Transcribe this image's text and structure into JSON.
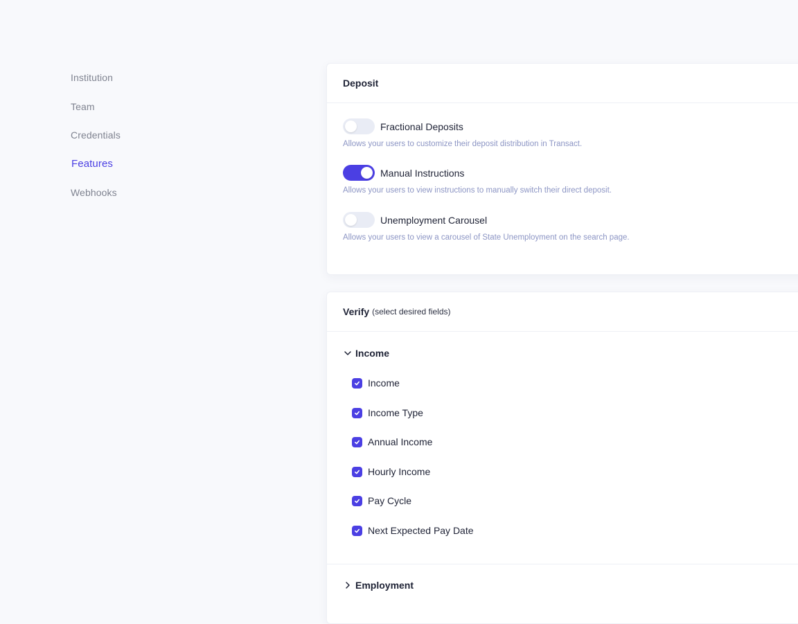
{
  "sidebar": {
    "items": [
      {
        "label": "Institution",
        "active": false
      },
      {
        "label": "Team",
        "active": false
      },
      {
        "label": "Credentials",
        "active": false
      },
      {
        "label": "Features",
        "active": true
      },
      {
        "label": "Webhooks",
        "active": false
      }
    ]
  },
  "deposit": {
    "title": "Deposit",
    "toggles": [
      {
        "label": "Fractional Deposits",
        "on": false,
        "description": "Allows your users to customize their deposit distribution in Transact."
      },
      {
        "label": "Manual Instructions",
        "on": true,
        "description": "Allows your users to view instructions to manually switch their direct deposit."
      },
      {
        "label": "Unemployment Carousel",
        "on": false,
        "description": "Allows your users to view a carousel of State Unemployment on the search page."
      }
    ]
  },
  "verify": {
    "title": "Verify",
    "subtitle": "(select desired fields)",
    "income": {
      "label": "Income",
      "expanded": true,
      "fields": [
        {
          "label": "Income",
          "checked": true
        },
        {
          "label": "Income Type",
          "checked": true
        },
        {
          "label": "Annual Income",
          "checked": true
        },
        {
          "label": "Hourly Income",
          "checked": true
        },
        {
          "label": "Pay Cycle",
          "checked": true
        },
        {
          "label": "Next Expected Pay Date",
          "checked": true
        }
      ]
    },
    "employment": {
      "label": "Employment",
      "expanded": false
    }
  },
  "colors": {
    "accent": "#4b3fe3",
    "description_text": "#8c95c4",
    "sidebar_text": "#7f8390"
  }
}
